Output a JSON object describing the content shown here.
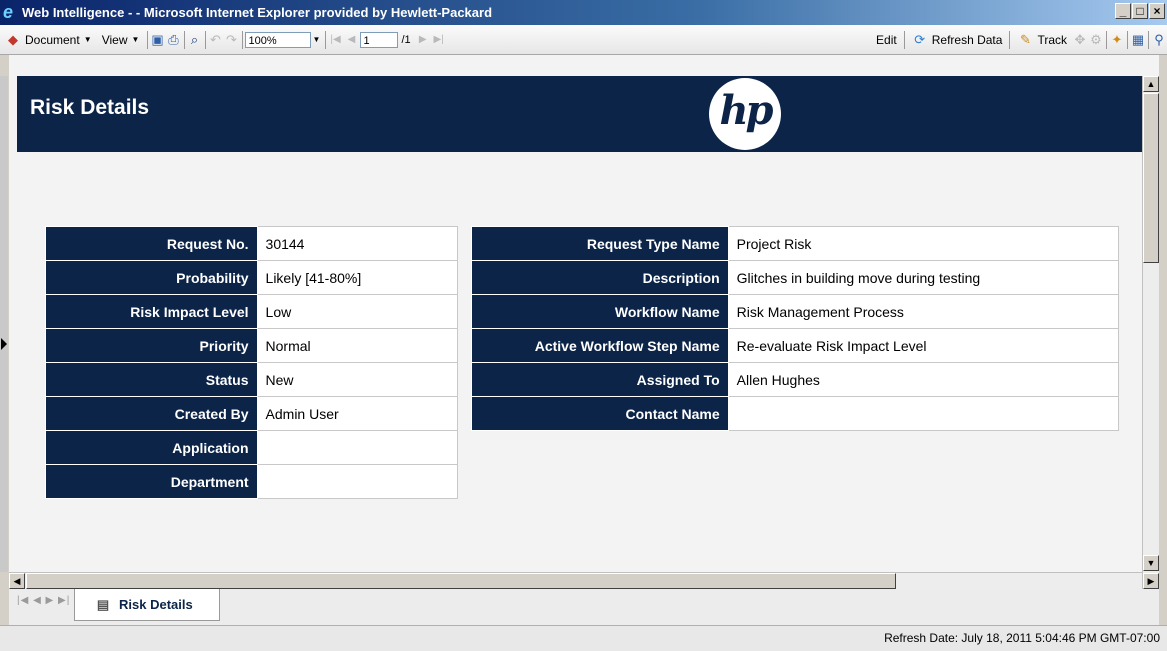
{
  "window": {
    "title": "Web Intelligence - - Microsoft Internet Explorer provided by Hewlett-Packard",
    "minimize": "_",
    "maximize": "□",
    "close": "×"
  },
  "toolbar": {
    "document_label": "Document",
    "view_label": "View",
    "zoom_value": "100%",
    "page_value": "1",
    "page_total": "/1",
    "edit_label": "Edit",
    "refresh_label": "Refresh Data",
    "track_label": "Track"
  },
  "report": {
    "title": "Risk Details",
    "logo_text": "hp",
    "left_table": [
      {
        "label": "Request No.",
        "value": "30144"
      },
      {
        "label": "Probability",
        "value": "Likely [41-80%]"
      },
      {
        "label": "Risk Impact Level",
        "value": "Low"
      },
      {
        "label": "Priority",
        "value": "Normal"
      },
      {
        "label": "Status",
        "value": "New"
      },
      {
        "label": "Created By",
        "value": "Admin User"
      },
      {
        "label": "Application",
        "value": ""
      },
      {
        "label": "Department",
        "value": ""
      }
    ],
    "right_table": [
      {
        "label": "Request Type Name",
        "value": "Project Risk"
      },
      {
        "label": "Description",
        "value": "Glitches in building move during testing"
      },
      {
        "label": "Workflow Name",
        "value": "Risk Management Process"
      },
      {
        "label": "Active Workflow Step Name",
        "value": "Re-evaluate Risk Impact Level"
      },
      {
        "label": "Assigned To",
        "value": "Allen Hughes"
      },
      {
        "label": "Contact Name",
        "value": ""
      }
    ]
  },
  "tabs": [
    {
      "label": "Risk Details",
      "active": true
    }
  ],
  "status": {
    "refresh_date": "Refresh Date: July 18, 2011 5:04:46 PM GMT-07:00"
  },
  "colors": {
    "header_navy": "#0b2448",
    "title_bar_start": "#0a246a"
  }
}
